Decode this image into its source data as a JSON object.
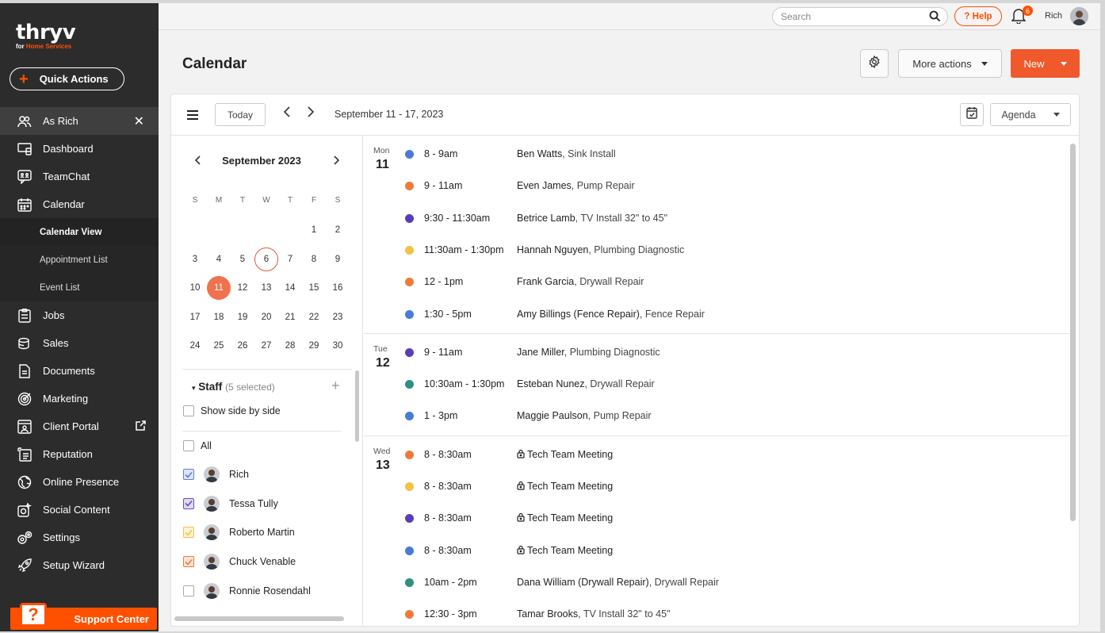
{
  "app": {
    "logo_word": "thryv",
    "logo_sub_for": "for ",
    "logo_sub": "Home Services",
    "quick_actions": "Quick Actions",
    "support_center": "Support Center"
  },
  "sidebar": {
    "user_item": "As Rich",
    "items": [
      {
        "label": "Dashboard",
        "icon": "dashboard-icon"
      },
      {
        "label": "TeamChat",
        "icon": "teamchat-icon"
      },
      {
        "label": "Calendar",
        "icon": "calendar-icon"
      },
      {
        "label": "Jobs",
        "icon": "jobs-icon"
      },
      {
        "label": "Sales",
        "icon": "sales-icon"
      },
      {
        "label": "Documents",
        "icon": "documents-icon"
      },
      {
        "label": "Marketing",
        "icon": "marketing-icon"
      },
      {
        "label": "Client Portal",
        "icon": "client-portal-icon"
      },
      {
        "label": "Reputation",
        "icon": "reputation-icon"
      },
      {
        "label": "Online Presence",
        "icon": "online-presence-icon"
      },
      {
        "label": "Social Content",
        "icon": "social-content-icon"
      },
      {
        "label": "Settings",
        "icon": "settings-icon"
      },
      {
        "label": "Setup Wizard",
        "icon": "setup-wizard-icon"
      }
    ],
    "calendar_sub": [
      "Calendar View",
      "Appointment List",
      "Event List"
    ]
  },
  "topbar": {
    "search_placeholder": "Search",
    "help": "? Help",
    "notif_count": "6",
    "user_name": "Rich"
  },
  "header": {
    "title": "Calendar",
    "more_actions": "More actions",
    "new": "New"
  },
  "toolbar": {
    "today": "Today",
    "range": "September 11 - 17, 2023",
    "view": "Agenda"
  },
  "mini_calendar": {
    "month": "September 2023",
    "weekdays": [
      "S",
      "M",
      "T",
      "W",
      "T",
      "F",
      "S"
    ],
    "weeks": [
      [
        "",
        "",
        "",
        "",
        "",
        "1",
        "2"
      ],
      [
        "3",
        "4",
        "5",
        "6",
        "7",
        "8",
        "9"
      ],
      [
        "10",
        "11",
        "12",
        "13",
        "14",
        "15",
        "16"
      ],
      [
        "17",
        "18",
        "19",
        "20",
        "21",
        "22",
        "23"
      ],
      [
        "24",
        "25",
        "26",
        "27",
        "28",
        "29",
        "30"
      ]
    ],
    "today": "6",
    "selected": "11"
  },
  "staff": {
    "title": "Staff",
    "count": "(5 selected)",
    "side_by_side": "Show side by side",
    "all": "All",
    "members": [
      {
        "name": "Rich",
        "checked": true,
        "color": "#5b7fd6"
      },
      {
        "name": "Tessa Tully",
        "checked": true,
        "color": "#6b4bb8"
      },
      {
        "name": "Roberto Martin",
        "checked": true,
        "color": "#f4c242"
      },
      {
        "name": "Chuck Venable",
        "checked": true,
        "color": "#f07a3a"
      },
      {
        "name": "Ronnie Rosendahl",
        "checked": false,
        "color": "#aaaaaa"
      }
    ]
  },
  "agenda": {
    "days": [
      {
        "dname": "Mon",
        "dnum": "11",
        "events": [
          {
            "time": "8 - 9am",
            "name": "Ben Watts",
            "desc": ", Sink Install",
            "color": "#4a7bd8",
            "lock": false
          },
          {
            "time": "9 - 11am",
            "name": "Even James",
            "desc": ", Pump Repair",
            "color": "#f07a3a",
            "lock": false
          },
          {
            "time": "9:30 - 11:30am",
            "name": "Betrice Lamb",
            "desc": ", TV Install 32\" to 45\"",
            "color": "#5b3cb8",
            "lock": false
          },
          {
            "time": "11:30am - 1:30pm",
            "name": "Hannah Nguyen",
            "desc": ", Plumbing Diagnostic",
            "color": "#f4c242",
            "lock": false
          },
          {
            "time": "12 - 1pm",
            "name": "Frank Garcia",
            "desc": ", Drywall Repair",
            "color": "#f07a3a",
            "lock": false
          },
          {
            "time": "1:30 - 5pm",
            "name": "Amy Billings (Fence Repair)",
            "desc": ", Fence Repair",
            "color": "#4a7bd8",
            "lock": false
          }
        ]
      },
      {
        "dname": "Tue",
        "dnum": "12",
        "events": [
          {
            "time": "9 - 11am",
            "name": "Jane Miller",
            "desc": ", Plumbing Diagnostic",
            "color": "#5b3cb8",
            "lock": false
          },
          {
            "time": "10:30am - 1:30pm",
            "name": "Esteban Nunez",
            "desc": ", Drywall Repair",
            "color": "#2e8f82",
            "lock": false
          },
          {
            "time": "1 - 3pm",
            "name": "Maggie Paulson",
            "desc": ", Pump Repair",
            "color": "#4a7bd8",
            "lock": false
          }
        ]
      },
      {
        "dname": "Wed",
        "dnum": "13",
        "events": [
          {
            "time": "8 - 8:30am",
            "name": "Tech Team Meeting",
            "desc": "",
            "color": "#f07a3a",
            "lock": true
          },
          {
            "time": "8 - 8:30am",
            "name": "Tech Team Meeting",
            "desc": "",
            "color": "#f4c242",
            "lock": true
          },
          {
            "time": "8 - 8:30am",
            "name": "Tech Team Meeting",
            "desc": "",
            "color": "#5b3cb8",
            "lock": true
          },
          {
            "time": "8 - 8:30am",
            "name": "Tech Team Meeting",
            "desc": "",
            "color": "#4a7bd8",
            "lock": true
          },
          {
            "time": "10am - 2pm",
            "name": "Dana William (Drywall Repair)",
            "desc": ", Drywall Repair",
            "color": "#2e8f82",
            "lock": false
          },
          {
            "time": "12:30 - 3pm",
            "name": "Tamar Brooks",
            "desc": ", TV Install 32\" to 45\"",
            "color": "#f07a3a",
            "lock": false
          }
        ]
      }
    ]
  },
  "colors": {
    "accent": "#ff5000",
    "new_button": "#f0592b",
    "sidebar_bg": "#2c2c2c"
  }
}
